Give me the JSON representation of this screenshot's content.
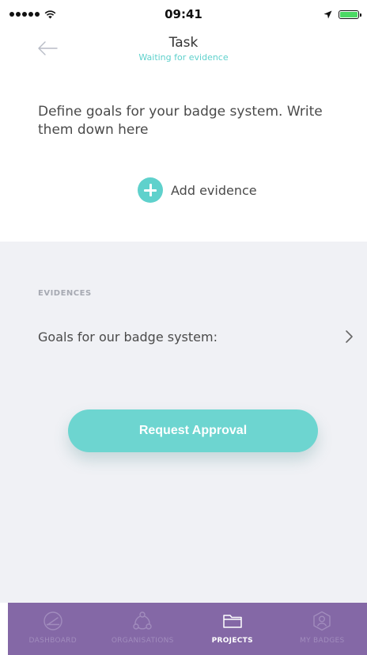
{
  "status_bar": {
    "time": "09:41"
  },
  "header": {
    "title": "Task",
    "subtitle": "Waiting for evidence"
  },
  "description": "Define goals for your badge system. Write them down here",
  "add_evidence": {
    "label": "Add evidence"
  },
  "evidences": {
    "section_label": "EVIDENCES",
    "items": [
      {
        "label": "Goals for our badge system:"
      }
    ]
  },
  "request_button": {
    "label": "Request Approval"
  },
  "tab_bar": {
    "tabs": [
      {
        "label": "DASHBOARD",
        "icon": "dashboard-icon",
        "active": false
      },
      {
        "label": "ORGANISATIONS",
        "icon": "organisations-icon",
        "active": false
      },
      {
        "label": "PROJECTS",
        "icon": "folder-icon",
        "active": true
      },
      {
        "label": "MY BADGES",
        "icon": "badge-icon",
        "active": false
      }
    ]
  },
  "colors": {
    "accent": "#5fd1cc",
    "button": "#6dd5d0",
    "panel_bg": "#f0f1f5",
    "tab_bar_bg": "#8468a6"
  }
}
